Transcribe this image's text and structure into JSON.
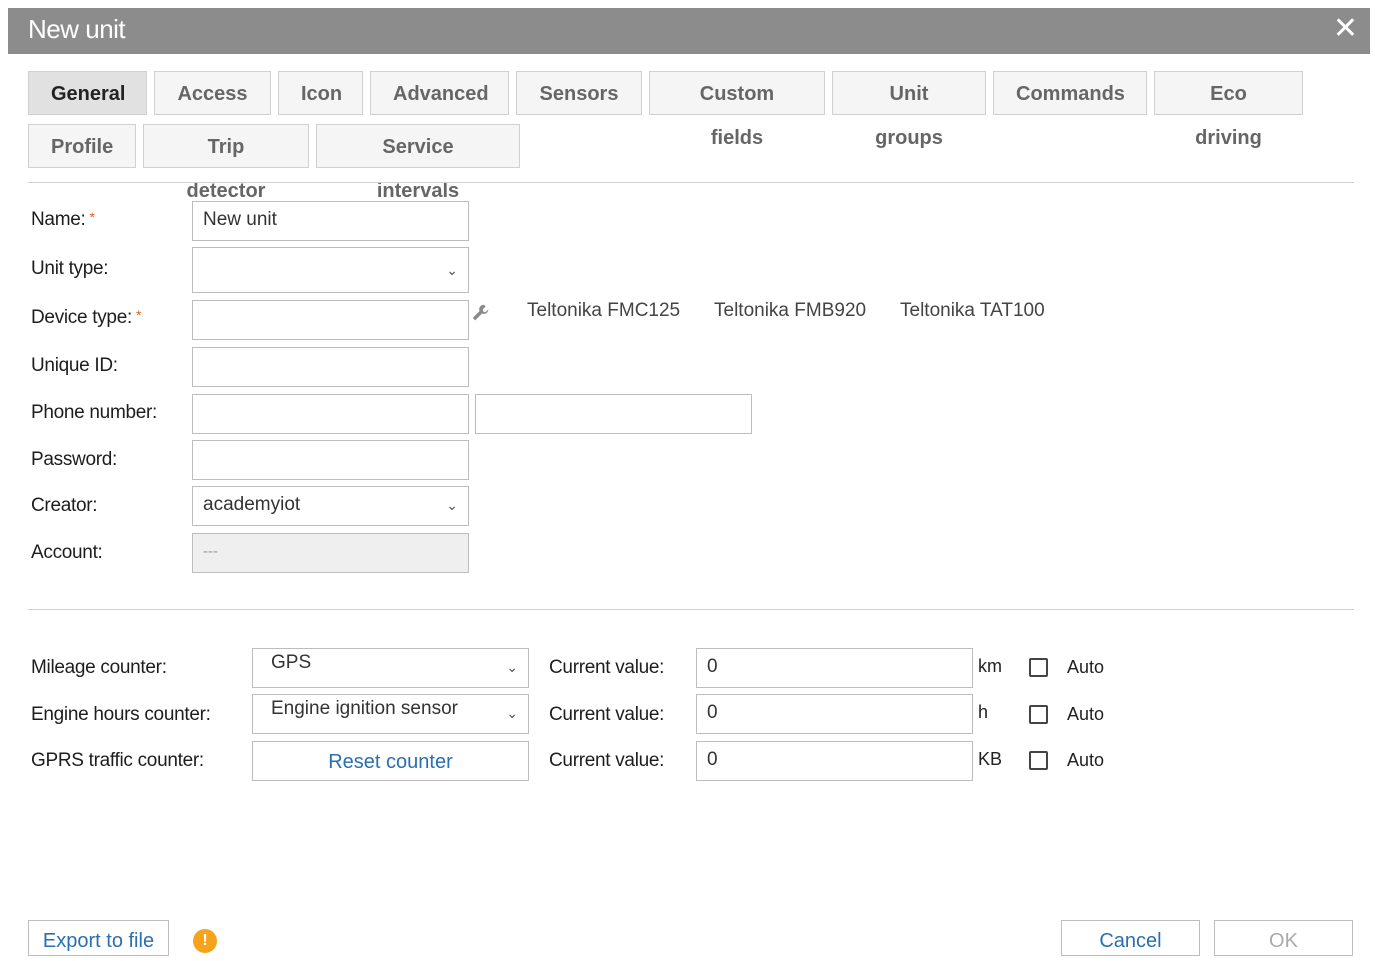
{
  "dialog": {
    "title": "New unit",
    "close_glyph": "✕"
  },
  "tabs": [
    {
      "label": "General",
      "active": true
    },
    {
      "label": "Access"
    },
    {
      "label": "Icon"
    },
    {
      "label": "Advanced"
    },
    {
      "label": "Sensors"
    },
    {
      "label": "Custom fields"
    },
    {
      "label": "Unit groups"
    },
    {
      "label": "Commands"
    },
    {
      "label": "Eco driving"
    },
    {
      "label": "Profile"
    },
    {
      "label": "Trip detector"
    },
    {
      "label": "Service intervals"
    }
  ],
  "form": {
    "name": {
      "label": "Name:",
      "required": "*",
      "value": "New unit"
    },
    "unit_type": {
      "label": "Unit type:",
      "value": ""
    },
    "device_type": {
      "label": "Device type:",
      "required": "*",
      "value": "",
      "suggestions": [
        "Teltonika FMC125",
        "Teltonika FMB920",
        "Teltonika TAT100"
      ]
    },
    "unique_id": {
      "label": "Unique ID:",
      "value": ""
    },
    "phone_number": {
      "label": "Phone number:",
      "value": "",
      "value2": ""
    },
    "password": {
      "label": "Password:",
      "value": ""
    },
    "creator": {
      "label": "Creator:",
      "value": "academyiot"
    },
    "account": {
      "label": "Account:",
      "value": "---"
    }
  },
  "counters": {
    "mileage": {
      "label": "Mileage counter:",
      "select": "GPS",
      "current_label": "Current value:",
      "value": "0",
      "unit": "km",
      "auto_label": "Auto"
    },
    "engine_hours": {
      "label": "Engine hours counter:",
      "select": "Engine ignition sensor",
      "current_label": "Current value:",
      "value": "0",
      "unit": "h",
      "auto_label": "Auto"
    },
    "gprs": {
      "label": "GPRS traffic counter:",
      "reset_label": "Reset counter",
      "current_label": "Current value:",
      "value": "0",
      "unit": "KB",
      "auto_label": "Auto"
    }
  },
  "footer": {
    "export_label": "Export to file",
    "warning_glyph": "!",
    "cancel_label": "Cancel",
    "ok_label": "OK"
  },
  "colors": {
    "titlebar": "#8c8c8c",
    "link": "#2a6fb0",
    "required": "#e06020",
    "warning": "#f7a21b"
  }
}
